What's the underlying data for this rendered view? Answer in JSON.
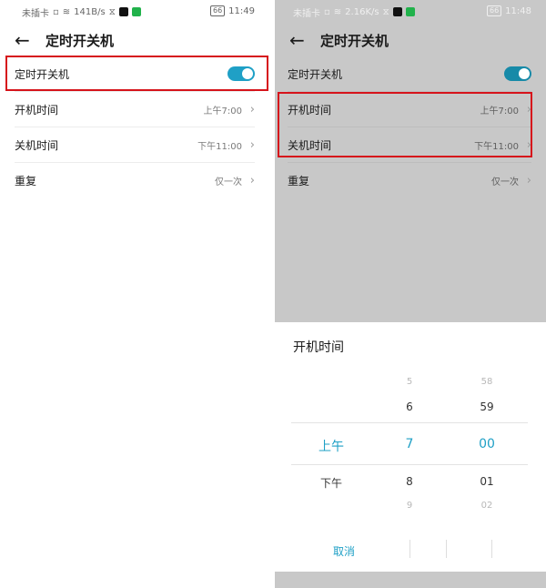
{
  "left": {
    "status": {
      "carrier": "未插卡",
      "speed": "141B/s",
      "battery": "66",
      "time": "11:49"
    },
    "back_icon": "←",
    "title": "定时开关机",
    "rows": [
      {
        "label": "定时开关机",
        "toggle_on": true
      },
      {
        "label": "开机时间",
        "value": "上午7:00"
      },
      {
        "label": "关机时间",
        "value": "下午11:00"
      },
      {
        "label": "重复",
        "value": "仅一次"
      }
    ]
  },
  "right": {
    "status": {
      "carrier": "未插卡",
      "speed": "2.16K/s",
      "battery": "66",
      "time": "11:48"
    },
    "back_icon": "←",
    "title": "定时开关机",
    "rows": [
      {
        "label": "定时开关机",
        "toggle_on": true
      },
      {
        "label": "开机时间",
        "value": "上午7:00"
      },
      {
        "label": "关机时间",
        "value": "下午11:00"
      },
      {
        "label": "重复",
        "value": "仅一次"
      }
    ],
    "picker": {
      "title": "开机时间",
      "ampm": {
        "selected": "上午",
        "next": "下午"
      },
      "hours": {
        "prev2": "5",
        "prev1": "6",
        "selected": "7",
        "next1": "8",
        "next2": "9"
      },
      "minutes": {
        "prev2": "58",
        "prev1": "59",
        "selected": "00",
        "next1": "01",
        "next2": "02"
      },
      "cancel": "取消"
    }
  },
  "chevron_icon": "›",
  "colors": {
    "accent": "#1fa0c6",
    "highlight": "#d6131b"
  }
}
